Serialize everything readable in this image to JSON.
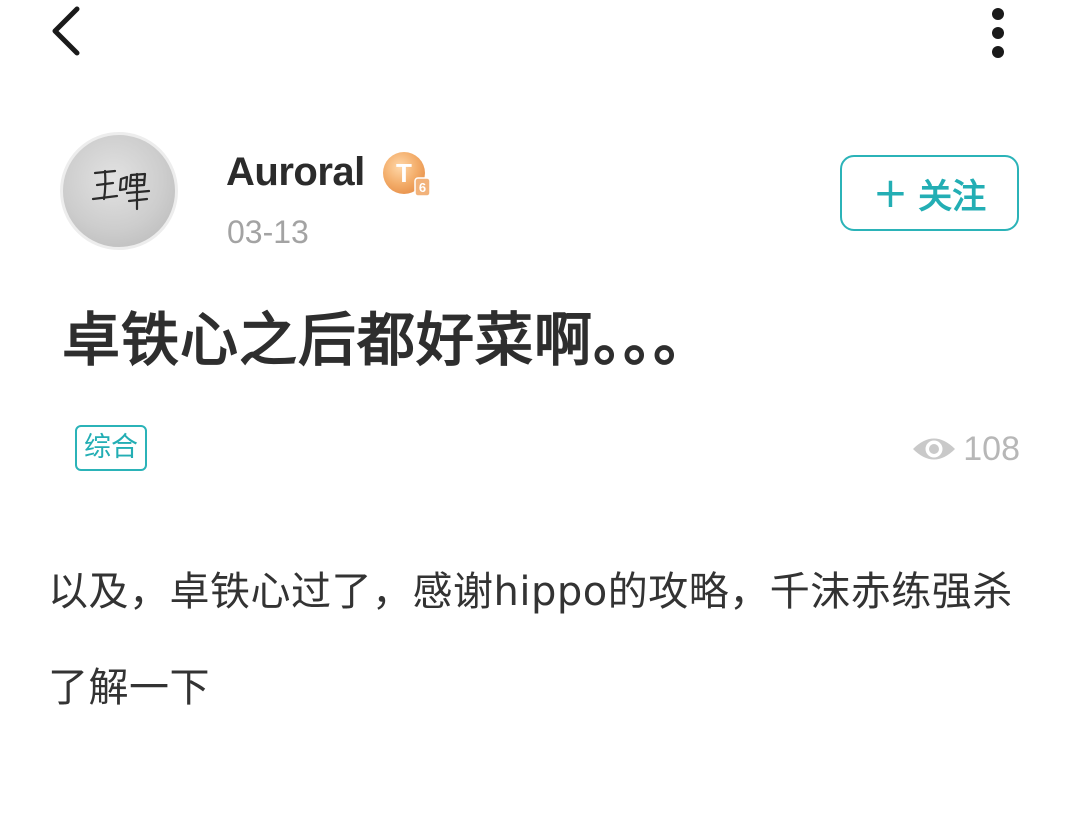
{
  "nav": {
    "back_icon": "chevron-left-icon",
    "more_icon": "vertical-ellipsis-icon"
  },
  "author": {
    "name": "Auroral",
    "avatar_text": "王啤",
    "level_badge": "T6",
    "date": "03-13"
  },
  "follow_button": {
    "plus": "+",
    "label": "关注"
  },
  "post": {
    "title": "卓铁心之后都好菜啊。。。",
    "category": "综合",
    "views": "108",
    "body": "以及，卓铁心过了，感谢hippo的攻略，千沫赤练强杀了解一下"
  },
  "colors": {
    "accent": "#2bb3b8",
    "badge_gold": "#f0a860",
    "muted_text": "#a3a3a3"
  }
}
